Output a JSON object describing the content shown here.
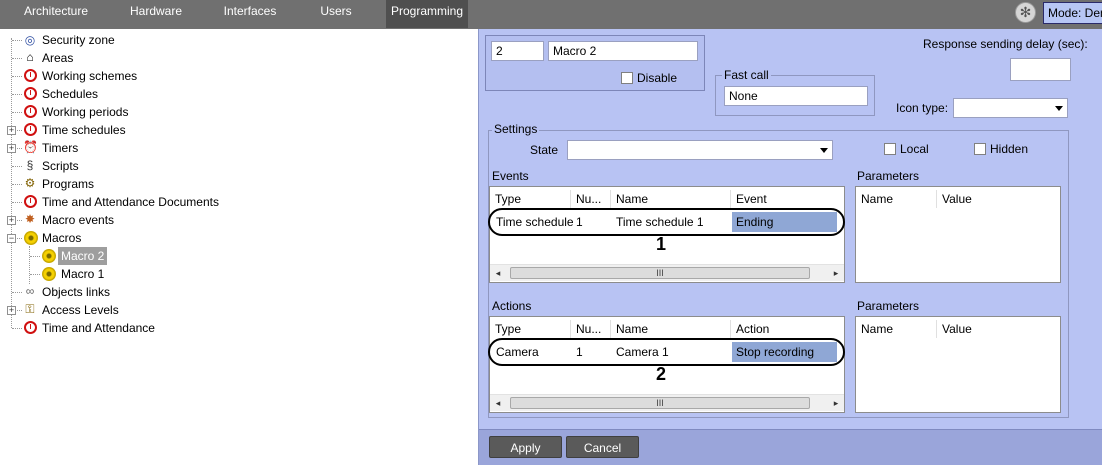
{
  "top_tabs": [
    {
      "label": "Architecture",
      "active": false
    },
    {
      "label": "Hardware",
      "active": false
    },
    {
      "label": "Interfaces",
      "active": false
    },
    {
      "label": "Users",
      "active": false
    },
    {
      "label": "Programming",
      "active": true
    }
  ],
  "mode_label": "Mode: Dem",
  "tree": {
    "items": [
      {
        "label": "Security zone",
        "icon": "security-zone-icon",
        "expandable": false
      },
      {
        "label": "Areas",
        "icon": "house-icon",
        "expandable": false
      },
      {
        "label": "Working schemes",
        "icon": "clock-icon",
        "expandable": false
      },
      {
        "label": "Schedules",
        "icon": "clock-icon",
        "expandable": false
      },
      {
        "label": "Working periods",
        "icon": "clock-icon",
        "expandable": false
      },
      {
        "label": "Time schedules",
        "icon": "clock-icon",
        "expandable": true
      },
      {
        "label": "Timers",
        "icon": "alarm-clock-icon",
        "expandable": true
      },
      {
        "label": "Scripts",
        "icon": "script-icon",
        "expandable": false
      },
      {
        "label": "Programs",
        "icon": "program-icon",
        "expandable": false
      },
      {
        "label": "Time and Attendance Documents",
        "icon": "clock-icon",
        "expandable": false
      },
      {
        "label": "Macro events",
        "icon": "macro-event-icon",
        "expandable": true
      },
      {
        "label": "Macros",
        "icon": "gear-icon",
        "expanded": true
      },
      {
        "label": "Macro 2",
        "icon": "gear-icon",
        "selected": true
      },
      {
        "label": "Macro 1",
        "icon": "gear-icon"
      },
      {
        "label": "Objects links",
        "icon": "link-icon",
        "expandable": false
      },
      {
        "label": "Access Levels",
        "icon": "keys-icon",
        "expandable": true
      },
      {
        "label": "Time and Attendance",
        "icon": "clock-icon",
        "expandable": false
      }
    ]
  },
  "macro": {
    "id": "2",
    "name": "Macro 2",
    "disable_label": "Disable",
    "fast_call_label": "Fast call",
    "fast_call_value": "None",
    "response_delay_label": "Response sending delay (sec):",
    "response_delay_value": "",
    "icon_type_label": "Icon type:",
    "icon_type_value": ""
  },
  "settings": {
    "group_label": "Settings",
    "state_label": "State",
    "state_value": "",
    "local_label": "Local",
    "hidden_label": "Hidden"
  },
  "events": {
    "label": "Events",
    "columns": [
      "Type",
      "Nu...",
      "Name",
      "Event"
    ],
    "rows": [
      {
        "type": "Time schedule",
        "num": "1",
        "name": "Time schedule 1",
        "event": "Ending"
      }
    ],
    "annotation": "1",
    "params_label": "Parameters",
    "params_columns": [
      "Name",
      "Value"
    ]
  },
  "actions": {
    "label": "Actions",
    "columns": [
      "Type",
      "Nu...",
      "Name",
      "Action"
    ],
    "rows": [
      {
        "type": "Camera",
        "num": "1",
        "name": "Camera 1",
        "action": "Stop recording"
      }
    ],
    "annotation": "2",
    "params_label": "Parameters",
    "params_columns": [
      "Name",
      "Value"
    ]
  },
  "scroll_thumb_glyph": "III",
  "buttons": {
    "apply": "Apply",
    "cancel": "Cancel"
  },
  "colors": {
    "topbar": "#707070",
    "panel": "#b8c3f3",
    "highlight": "#8fa7d5",
    "clock_red": "#d01010"
  }
}
